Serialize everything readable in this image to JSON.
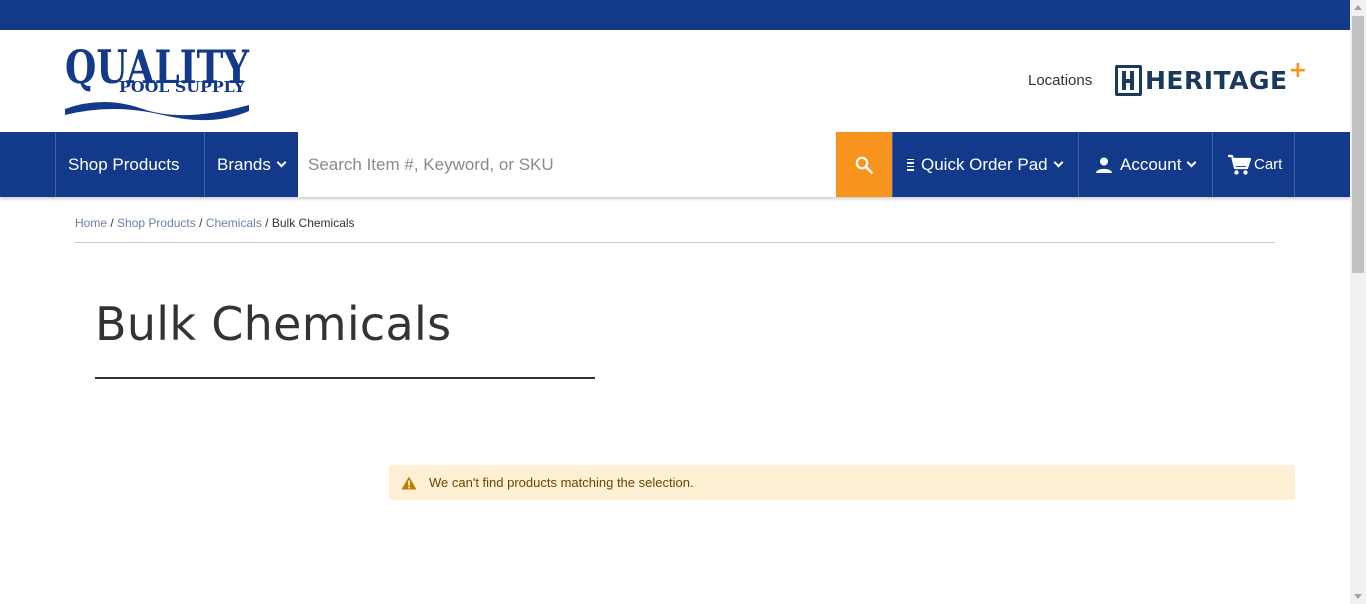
{
  "header": {
    "logo_text_main": "QUALITY",
    "logo_text_sub": "POOL SUPPLY",
    "locations_label": "Locations",
    "partner_logo_text": "HERITAGE",
    "partner_logo_plus": "+"
  },
  "nav": {
    "shop_products": "Shop Products",
    "brands": "Brands",
    "search_placeholder": "Search Item #, Keyword, or SKU",
    "search_value": "",
    "quick_order_pad": "Quick Order Pad",
    "account": "Account",
    "cart": "Cart"
  },
  "breadcrumb": {
    "items": [
      "Home",
      "Shop Products",
      "Chemicals"
    ],
    "separator": "/",
    "current": "Bulk Chemicals"
  },
  "main": {
    "page_title": "Bulk Chemicals",
    "notice_message": "We can't find products matching the selection."
  },
  "colors": {
    "brand_blue": "#13398a",
    "accent_orange": "#f7941d",
    "notice_bg": "#fdf0d5",
    "notice_text": "#6f4400"
  },
  "icons": {
    "search": "search-icon",
    "chevron": "chevron-down-icon",
    "quick_order": "list-icon",
    "account": "user-icon",
    "cart": "cart-icon",
    "warning": "warning-icon"
  }
}
